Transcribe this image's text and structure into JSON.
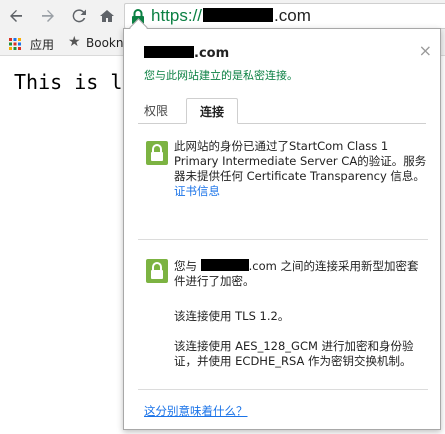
{
  "toolbar": {
    "back_icon": "arrow-left-icon",
    "forward_icon": "arrow-right-icon",
    "reload_icon": "reload-icon",
    "home_icon": "home-icon",
    "url_scheme": "https://",
    "url_domain": ".com",
    "lock_color": "#0b8043"
  },
  "bookmarks": {
    "apps_label": "应用",
    "bookmark_label": "Bookn"
  },
  "page": {
    "text": "This is l"
  },
  "popup": {
    "site_suffix": ".com",
    "secure_message": "您与此网站建立的是私密连接。",
    "tabs": [
      {
        "label": "权限"
      },
      {
        "label": "连接"
      }
    ],
    "identity_text": "此网站的身份已通过了StartCom Class 1 Primary Intermediate Server CA的验证。服务器未提供任何 Certificate Transparency 信息。",
    "certificate_link": "证书信息",
    "conn_prefix": "您与",
    "conn_suffix": ".com 之间的连接采用新型加密套件进行了加密。",
    "tls_text": "该连接使用 TLS 1.2。",
    "cipher_text": "该连接使用 AES_128_GCM 进行加密和身份验证，并使用 ECDHE_RSA 作为密钥交换机制。",
    "footer_link": "这分别意味着什么？",
    "close_label": "×",
    "accent_green": "#0b8043",
    "link_color": "#1a73e8"
  }
}
